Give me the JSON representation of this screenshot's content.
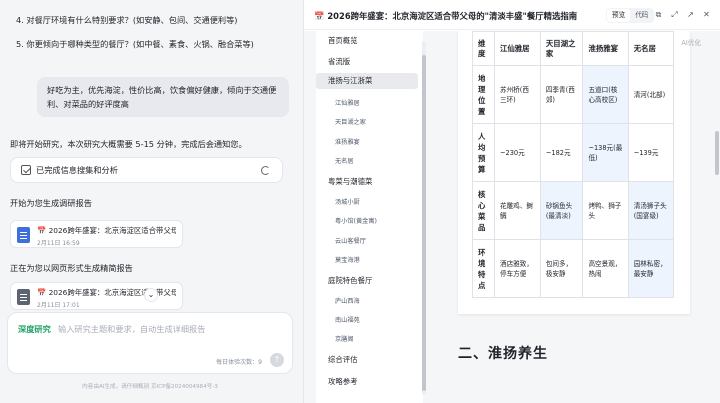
{
  "chat": {
    "q4": "4. 对餐厅环境有什么特别要求？(如安静、包间、交通便利等)",
    "q5": "5. 你更倾向于哪种类型的餐厅？(如中餐、素食、火锅、融合菜等)",
    "user_reply": "好吃为主，优先海淀，性价比高，饮食偏好健康，倾向于交通便利、对菜品的好评度高",
    "research_start": "即将开始研究，本次研究大概需要 5-15 分钟，完成后会通知您。",
    "status_label": "已完成信息搜集和分析",
    "gen_report": "开始为您生成调研报告",
    "card1_title": "2026跨年盛宴：北京海淀区适合带父母的...",
    "card1_date": "2月11日 16:59",
    "gen_web": "正在为您以网页形式生成精简报告",
    "card2_title": "2026跨年盛宴：北京海淀区适合带父母的...",
    "card2_date": "2月11日 17:01",
    "composer_mode": "深度研究",
    "composer_placeholder": "输入研究主题和要求，自动生成详细报告",
    "quota": "每日体验次数：9",
    "footer": "内容由AI生成，请仔细甄别    京ICP备2024004984号-3"
  },
  "preview": {
    "title": "2026跨年盛宴：北京海淀区适合带父母的\"清淡丰盛\"餐厅精选指南",
    "tabs": [
      "预览",
      "代码"
    ],
    "edit_label": "AI优化",
    "toc": [
      {
        "label": "首页概览",
        "level": 1
      },
      {
        "label": "省流版",
        "level": 1
      },
      {
        "label": "淮扬与江浙菜",
        "level": 1,
        "active": true
      },
      {
        "label": "江仙雅居",
        "level": 2
      },
      {
        "label": "天目湖之家",
        "level": 2
      },
      {
        "label": "淮扬雅宴",
        "level": 2
      },
      {
        "label": "无名居",
        "level": 2
      },
      {
        "label": "粤菜与潮德菜",
        "level": 1
      },
      {
        "label": "汤城小厨",
        "level": 2
      },
      {
        "label": "粤小馆(黄金寓)",
        "level": 2
      },
      {
        "label": "云山客餐厅",
        "level": 2
      },
      {
        "label": "莫宝海港",
        "level": 2
      },
      {
        "label": "庭院特色餐厅",
        "level": 1
      },
      {
        "label": "庐山西海",
        "level": 2
      },
      {
        "label": "南山福苑",
        "level": 2
      },
      {
        "label": "京膳阁",
        "level": 2
      },
      {
        "label": "综合评估",
        "level": 1
      },
      {
        "label": "攻略参考",
        "level": 1
      }
    ],
    "table": {
      "headers": [
        "维度",
        "江仙雅居",
        "天目湖之家",
        "淮扬雅宴",
        "无名居"
      ],
      "rows": [
        [
          "地理位置",
          "苏州桥(西三环)",
          "四季青(西郊)",
          "五道口(核心高校区)",
          "清河(北部)"
        ],
        [
          "人均预算",
          "~230元",
          "~182元",
          "~138元(最低)",
          "~139元"
        ],
        [
          "核心菜品",
          "花雕鸡、鲥鲷",
          "砂锅鱼头(最清淡)",
          "烤鸭、狮子头",
          "清汤狮子头(国宴级)"
        ],
        [
          "环境特点",
          "酒店雅致，停车方便",
          "包间多，极安静",
          "高空景观，热闹",
          "园林私密，最安静"
        ]
      ]
    },
    "next_heading": "二、淮扬养生"
  },
  "colors": {
    "accent_green": "#1fa065",
    "highlight_cell": "#eef4fd",
    "doc_icon_blue": "#3f6fd8",
    "doc_icon_gray": "#5b6470"
  }
}
